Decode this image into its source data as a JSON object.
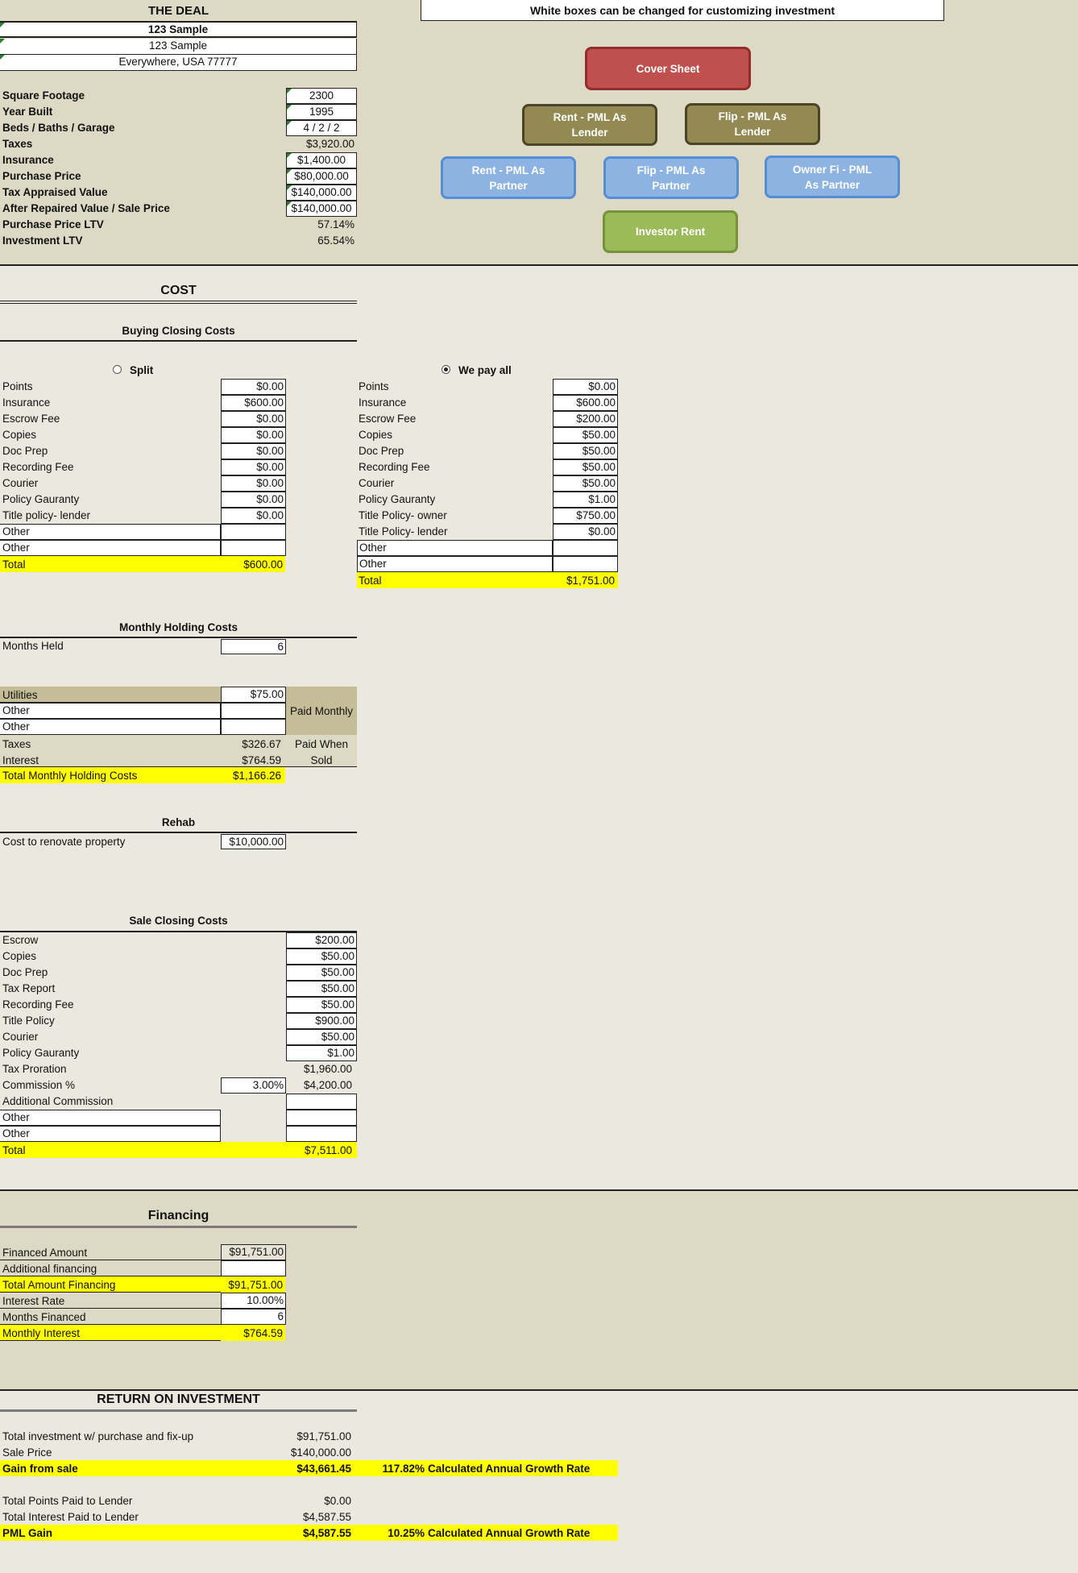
{
  "deal": {
    "title": "THE DEAL",
    "addr1": "123 Sample",
    "addr2": "123 Sample",
    "addr3": "Everywhere, USA  77777",
    "rows": [
      {
        "label": "Square Footage",
        "value": "2300",
        "boxed": true
      },
      {
        "label": "Year Built",
        "value": "1995",
        "boxed": true
      },
      {
        "label": "Beds / Baths / Garage",
        "value": "4  /  2  /  2",
        "boxed": true
      },
      {
        "label": "Taxes",
        "value": "$3,920.00",
        "boxed": false
      },
      {
        "label": "Insurance",
        "value": "$1,400.00",
        "boxed": true
      },
      {
        "label": "Purchase Price",
        "value": "$80,000.00",
        "boxed": true
      },
      {
        "label": "Tax Appraised Value",
        "value": "$140,000.00",
        "boxed": true
      },
      {
        "label": "After Repaired Value / Sale Price",
        "value": "$140,000.00",
        "boxed": true
      },
      {
        "label": "Purchase Price LTV",
        "value": "57.14%",
        "boxed": false
      },
      {
        "label": "Investment LTV",
        "value": "65.54%",
        "boxed": false
      }
    ]
  },
  "banner": "White boxes can be changed for customizing investment",
  "nav": {
    "cover": "Cover Sheet",
    "rent_lender": "Rent - PML As Lender",
    "flip_lender": "Flip - PML As Lender",
    "rent_partner": "Rent - PML As Partner",
    "flip_partner": "Flip - PML As Partner",
    "ownerfi_partner": "Owner Fi - PML As Partner",
    "investor_rent": "Investor Rent"
  },
  "cost": {
    "title": "COST",
    "buying_title": "Buying Closing Costs",
    "split_label": "Split",
    "wepay_label": "We pay all",
    "split_rows": [
      {
        "label": "Points",
        "value": "$0.00"
      },
      {
        "label": "Insurance",
        "value": "$600.00"
      },
      {
        "label": "Escrow Fee",
        "value": "$0.00"
      },
      {
        "label": "Copies",
        "value": "$0.00"
      },
      {
        "label": "Doc Prep",
        "value": "$0.00"
      },
      {
        "label": "Recording Fee",
        "value": "$0.00"
      },
      {
        "label": "Courier",
        "value": "$0.00"
      },
      {
        "label": "Policy Gauranty",
        "value": "$0.00"
      },
      {
        "label": "Title policy- lender",
        "value": "$0.00"
      },
      {
        "label": "Other",
        "value": ""
      },
      {
        "label": "Other",
        "value": ""
      }
    ],
    "split_total_label": "Total",
    "split_total": "$600.00",
    "wepay_rows": [
      {
        "label": "Points",
        "value": "$0.00"
      },
      {
        "label": "Insurance",
        "value": "$600.00"
      },
      {
        "label": "Escrow Fee",
        "value": "$200.00"
      },
      {
        "label": "Copies",
        "value": "$50.00"
      },
      {
        "label": "Doc Prep",
        "value": "$50.00"
      },
      {
        "label": "Recording Fee",
        "value": "$50.00"
      },
      {
        "label": "Courier",
        "value": "$50.00"
      },
      {
        "label": "Policy Gauranty",
        "value": "$1.00"
      },
      {
        "label": "Title Policy- owner",
        "value": "$750.00"
      },
      {
        "label": "Title Policy- lender",
        "value": "$0.00"
      },
      {
        "label": "Other",
        "value": ""
      },
      {
        "label": "Other",
        "value": ""
      }
    ],
    "wepay_total_label": "Total",
    "wepay_total": "$1,751.00"
  },
  "holding": {
    "title": "Monthly Holding Costs",
    "months_label": "Months Held",
    "months": "6",
    "utilities_label": "Utilities",
    "utilities": "$75.00",
    "other1": "Other",
    "other2": "Other",
    "paid_monthly": "Paid Monthly",
    "taxes_label": "Taxes",
    "taxes": "$326.67",
    "interest_label": "Interest",
    "interest": "$764.59",
    "paid_when": "Paid When",
    "sold": "Sold",
    "total_label": "Total Monthly Holding Costs",
    "total": "$1,166.26"
  },
  "rehab": {
    "title": "Rehab",
    "label": "Cost to renovate property",
    "value": "$10,000.00"
  },
  "sale": {
    "title": "Sale Closing Costs",
    "rows": [
      {
        "label": "Escrow",
        "value": "$200.00"
      },
      {
        "label": "Copies",
        "value": "$50.00"
      },
      {
        "label": "Doc Prep",
        "value": "$50.00"
      },
      {
        "label": "Tax Report",
        "value": "$50.00"
      },
      {
        "label": "Recording Fee",
        "value": "$50.00"
      },
      {
        "label": "Title Policy",
        "value": "$900.00"
      },
      {
        "label": "Courier",
        "value": "$50.00"
      },
      {
        "label": "Policy Gauranty",
        "value": "$1.00"
      }
    ],
    "tax_proration_label": "Tax Proration",
    "tax_proration": "$1,960.00",
    "commission_label": "Commission %",
    "commission_pct": "3.00%",
    "commission": "$4,200.00",
    "additional_label": "Additional Commission",
    "other1": "Other",
    "other2": "Other",
    "total_label": "Total",
    "total": "$7,511.00"
  },
  "financing": {
    "title": "Financing",
    "rows": [
      {
        "label": "Financed Amount",
        "value": "$91,751.00"
      },
      {
        "label": "Additional financing",
        "value": ""
      },
      {
        "label": "Total Amount Financing",
        "value": "$91,751.00"
      },
      {
        "label": "Interest Rate",
        "value": "10.00%"
      },
      {
        "label": "Months Financed",
        "value": "6"
      },
      {
        "label": "Monthly Interest",
        "value": "$764.59"
      }
    ]
  },
  "roi": {
    "title": "RETURN ON INVESTMENT",
    "total_inv_label": "Total investment w/ purchase and fix-up",
    "total_inv": "$91,751.00",
    "sale_price_label": "Sale Price",
    "sale_price": "$140,000.00",
    "gain_label": "Gain from sale",
    "gain": "$43,661.45",
    "gain_rate": "117.82%",
    "rate_label": "Calculated Annual Growth Rate",
    "points_label": "Total Points Paid to Lender",
    "points": "$0.00",
    "interest_label": "Total Interest Paid to Lender",
    "interest": "$4,587.55",
    "pml_label": "PML Gain",
    "pml": "$4,587.55",
    "pml_rate": "10.25%",
    "pml_rate_label": "Calculated Annual Growth Rate"
  },
  "colors": {
    "band_tan": "#ddd9c4",
    "band_light": "#ebe9df",
    "highlight": "#ffff00",
    "tan_cell": "#c4bd97"
  }
}
